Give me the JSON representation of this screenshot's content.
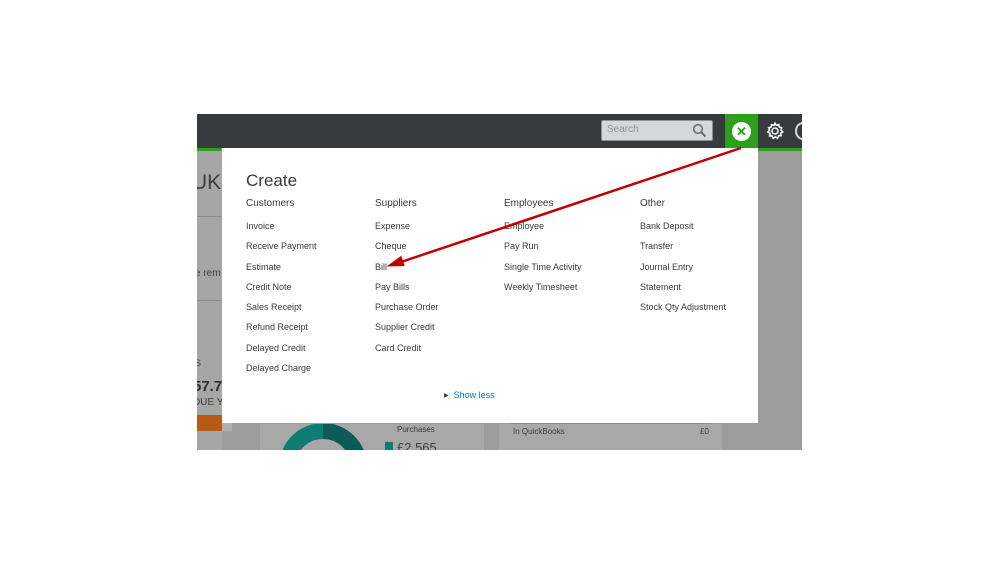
{
  "header": {
    "search_placeholder": "Search",
    "close_symbol": "✕",
    "icons": [
      "search-icon",
      "close-icon",
      "gear-icon"
    ]
  },
  "background": {
    "title_fragment": "UK",
    "text_fragment_1": "e rem",
    "text_fragment_2": "S",
    "amount_fragment": "57.7",
    "due_fragment": "DUE Y",
    "purchases_label": "Purchases",
    "purchases_value": "£2,565",
    "qb_label": "In QuickBooks",
    "qb_value": "£0"
  },
  "create_menu": {
    "title": "Create",
    "show_less": "Show less",
    "columns": [
      {
        "heading": "Customers",
        "items": [
          "Invoice",
          "Receive Payment",
          "Estimate",
          "Credit Note",
          "Sales Receipt",
          "Refund Receipt",
          "Delayed Credit",
          "Delayed Charge"
        ]
      },
      {
        "heading": "Suppliers",
        "items": [
          "Expense",
          "Cheque",
          "Bill",
          "Pay Bills",
          "Purchase Order",
          "Supplier Credit",
          "Card Credit"
        ]
      },
      {
        "heading": "Employees",
        "items": [
          "Employee",
          "Pay Run",
          "Single Time Activity",
          "Weekly Timesheet"
        ]
      },
      {
        "heading": "Other",
        "items": [
          "Bank Deposit",
          "Transfer",
          "Journal Entry",
          "Statement",
          "Stock Qty Adjustment"
        ]
      }
    ]
  },
  "colors": {
    "accent_green": "#2ca01c",
    "topbar": "#393a3d",
    "link_blue": "#0077c5",
    "annotation_red": "#c00000"
  }
}
